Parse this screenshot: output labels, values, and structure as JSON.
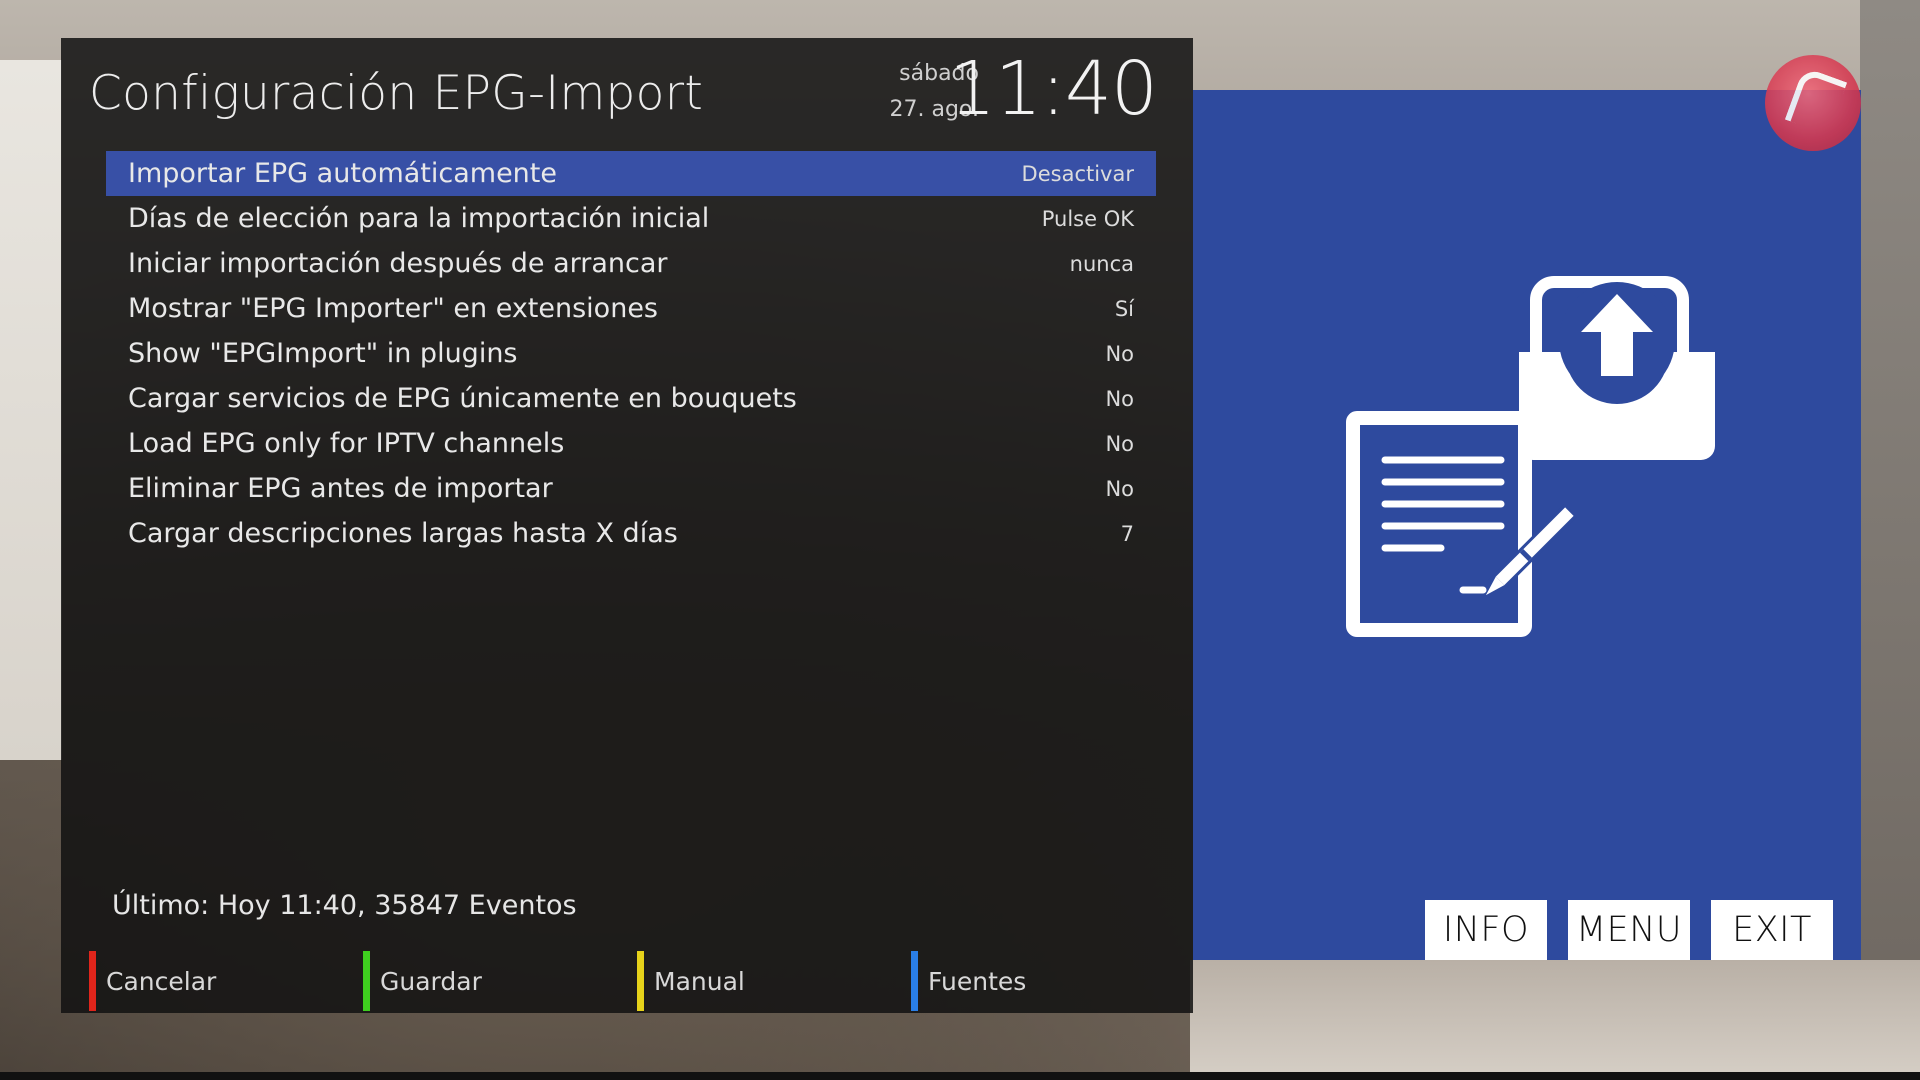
{
  "screen": {
    "title": "Configuración EPG-Import",
    "day": "sábado",
    "date": "27. ago.",
    "time": "11:40"
  },
  "settings": [
    {
      "label": "Importar EPG automáticamente",
      "value": "Desactivar",
      "selected": true
    },
    {
      "label": "Días de elección para la importación inicial",
      "value": "Pulse OK",
      "selected": false
    },
    {
      "label": "Iniciar importación después de arrancar",
      "value": "nunca",
      "selected": false
    },
    {
      "label": "Mostrar \"EPG Importer\" en extensiones",
      "value": "Sí",
      "selected": false
    },
    {
      "label": "Show \"EPGImport\" in plugins",
      "value": "No",
      "selected": false
    },
    {
      "label": "Cargar servicios de EPG únicamente en bouquets",
      "value": "No",
      "selected": false
    },
    {
      "label": "Load EPG only for IPTV channels",
      "value": "No",
      "selected": false
    },
    {
      "label": "Eliminar EPG antes de importar",
      "value": "No",
      "selected": false
    },
    {
      "label": "Cargar descripciones largas hasta X días",
      "value": "7",
      "selected": false
    }
  ],
  "status": {
    "last_import": "Último: Hoy 11:40, 35847 Eventos"
  },
  "color_keys": [
    {
      "label": "Cancelar",
      "color": "#e0251b"
    },
    {
      "label": "Guardar",
      "color": "#3fcf1f"
    },
    {
      "label": "Manual",
      "color": "#e6d21a"
    },
    {
      "label": "Fuentes",
      "color": "#2a7ee6"
    }
  ],
  "hw_buttons": [
    {
      "label": "INFO"
    },
    {
      "label": "MENU"
    },
    {
      "label": "EXIT"
    }
  ],
  "illustration": {
    "icon": "epg-import-document-upload-icon",
    "panel_color": "#2e4a9e"
  },
  "colors": {
    "selection": "#3850a6",
    "panel_bg": "#121212"
  }
}
